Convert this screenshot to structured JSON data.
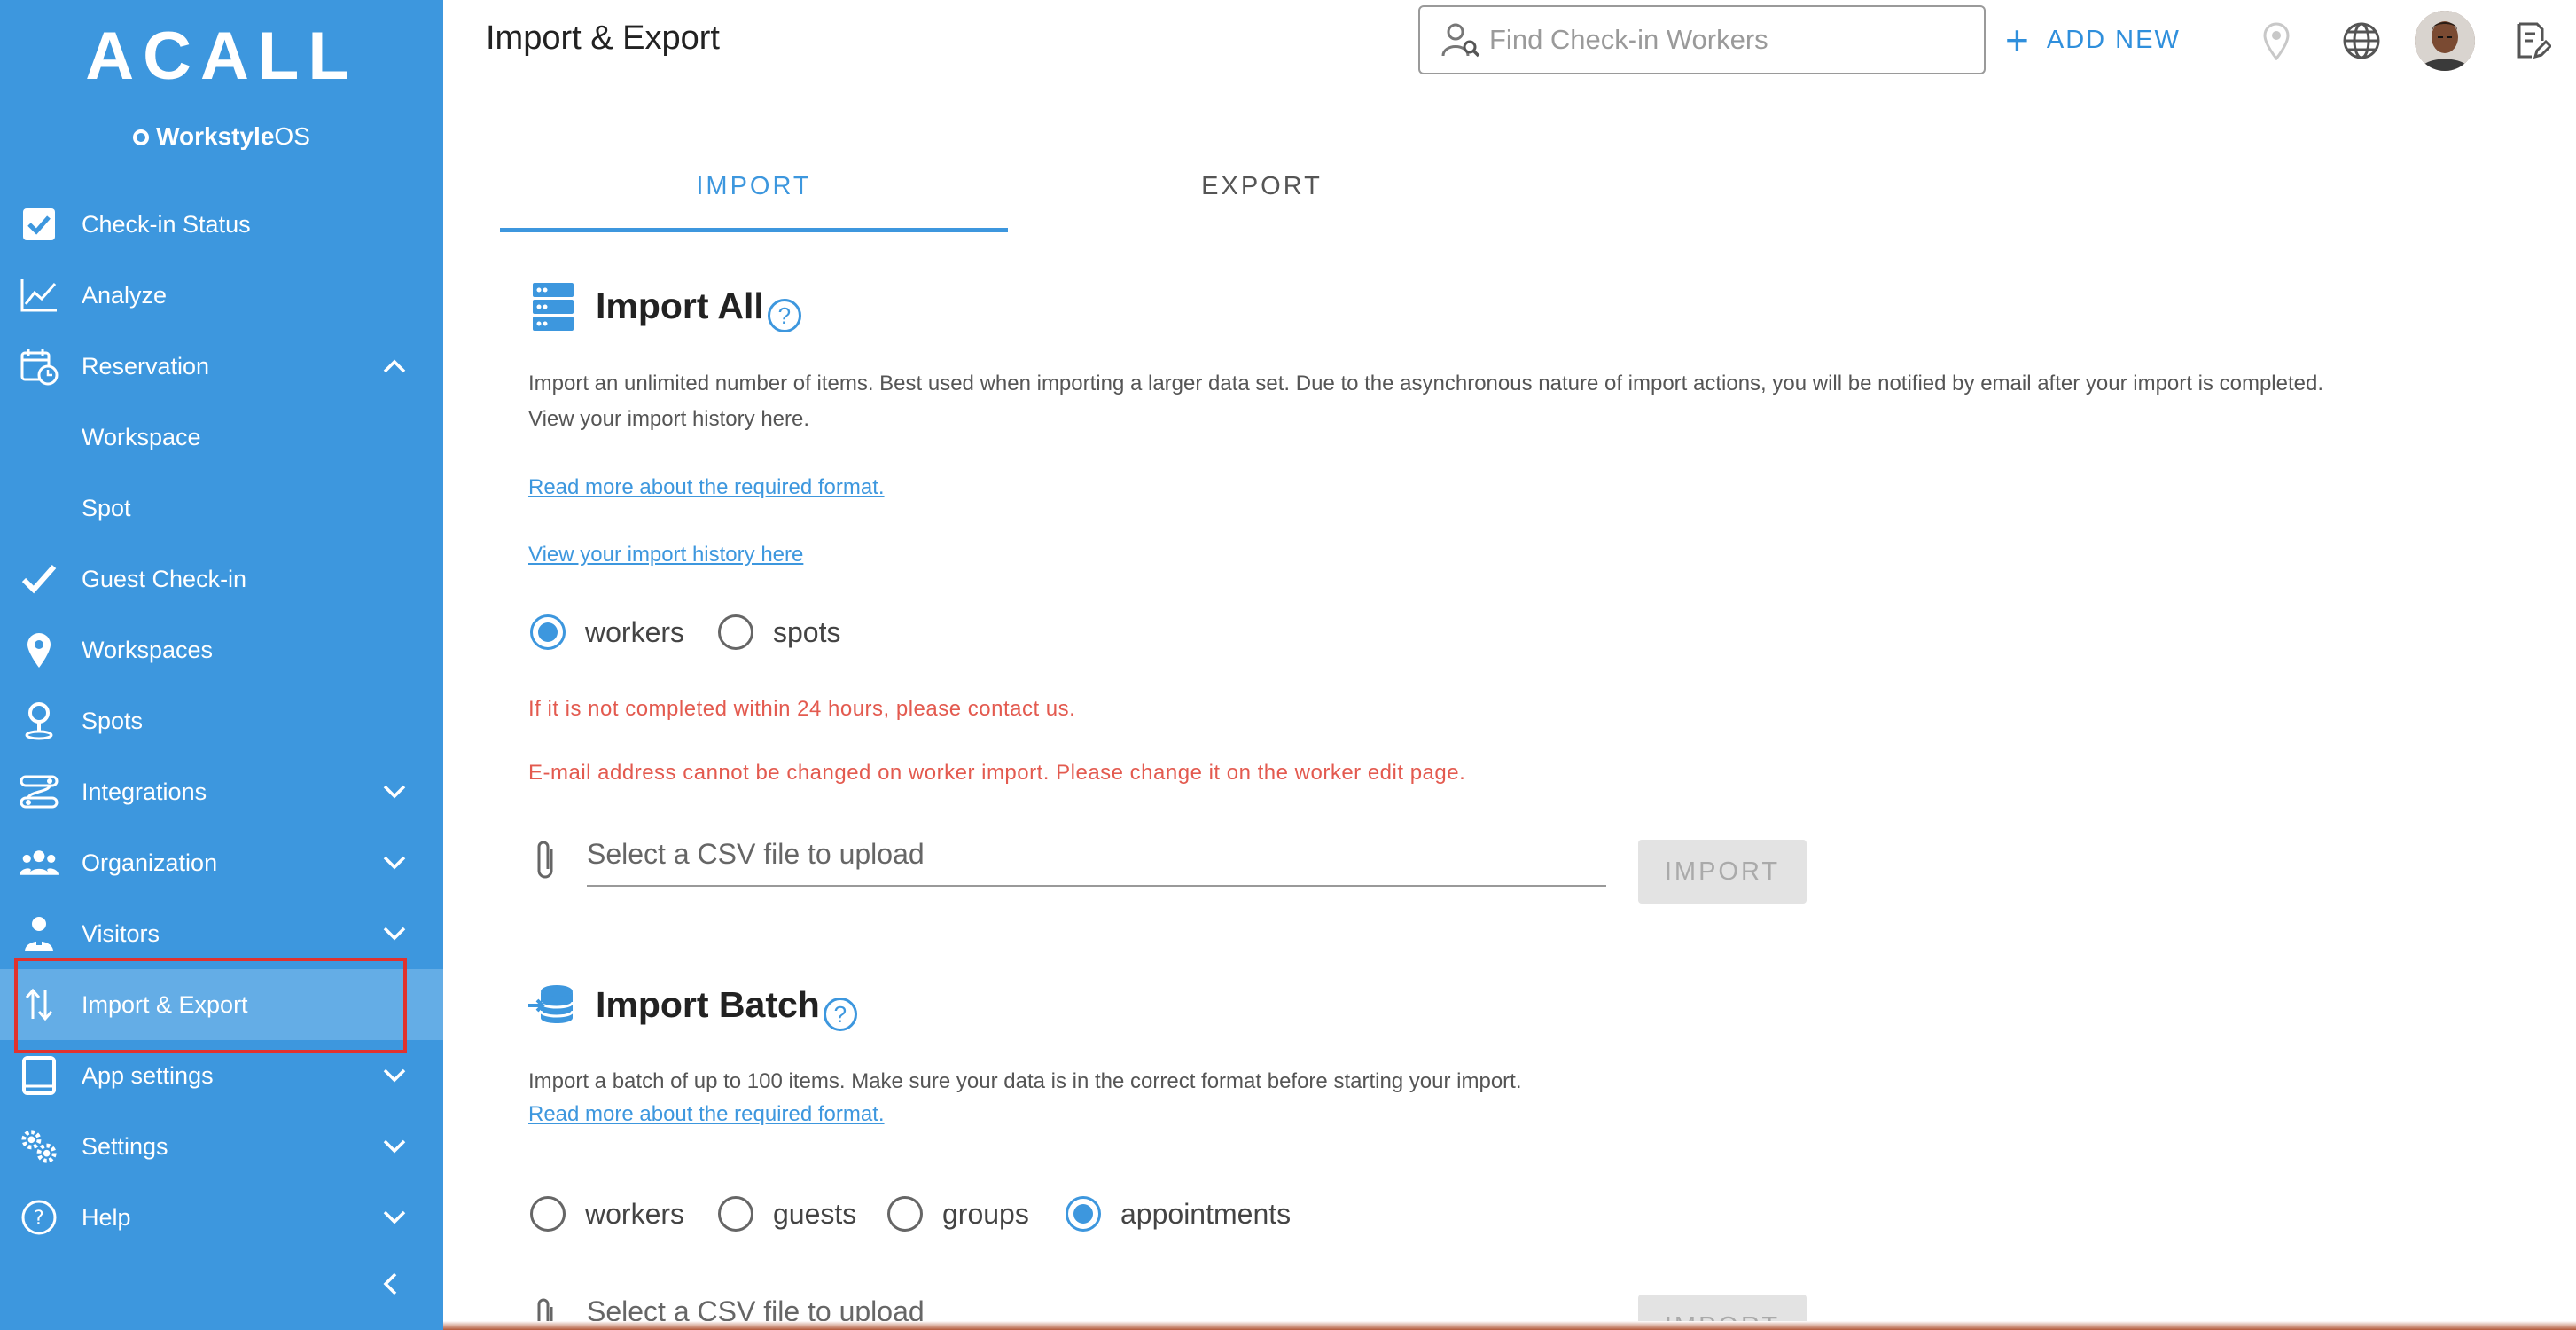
{
  "colors": {
    "sidebar": "#3d97de",
    "sidebar_active": "#64ade6",
    "accent": "#3d97de",
    "warning": "#e35a4f",
    "highlight": "#e0322e"
  },
  "brand": {
    "logo": "ACALL",
    "sub_bold": "Workstyle",
    "sub_rest": "OS"
  },
  "sidebar": {
    "items": [
      {
        "label": "Check-in Status",
        "icon": "checkbox-icon"
      },
      {
        "label": "Analyze",
        "icon": "line-chart-icon"
      },
      {
        "label": "Reservation",
        "icon": "calendar-clock-icon",
        "chevron": "up"
      },
      {
        "label": "Workspace"
      },
      {
        "label": "Spot"
      },
      {
        "label": "Guest Check-in",
        "icon": "checkmark-icon"
      },
      {
        "label": "Workspaces",
        "icon": "map-pin-icon"
      },
      {
        "label": "Spots",
        "icon": "person-pin-icon"
      },
      {
        "label": "Integrations",
        "icon": "integrations-icon",
        "chevron": "down"
      },
      {
        "label": "Organization",
        "icon": "group-icon",
        "chevron": "down"
      },
      {
        "label": "Visitors",
        "icon": "visitor-icon",
        "chevron": "down"
      },
      {
        "label": "Import & Export",
        "icon": "import-export-icon",
        "active": true
      },
      {
        "label": "App settings",
        "icon": "tablet-icon",
        "chevron": "down"
      },
      {
        "label": "Settings",
        "icon": "gears-icon",
        "chevron": "down"
      },
      {
        "label": "Help",
        "icon": "help-circle-icon",
        "chevron": "down"
      }
    ]
  },
  "header": {
    "title": "Import & Export",
    "search_placeholder": "Find Check-in Workers",
    "add_new": "ADD NEW"
  },
  "tabs": [
    {
      "label": "IMPORT",
      "active": true
    },
    {
      "label": "EXPORT",
      "active": false
    }
  ],
  "import_all": {
    "title": "Import All",
    "desc_line1": "Import an unlimited number of items. Best used when importing a larger data set. Due to the asynchronous nature of import actions, you will be notified by email after your import is completed.",
    "desc_line2": "View your import history here.",
    "format_link": "Read more about the required format.",
    "history_link": "View your import history here",
    "radios": [
      {
        "label": "workers",
        "checked": true
      },
      {
        "label": "spots",
        "checked": false
      }
    ],
    "warning1": "If it is not completed within 24 hours, please contact us.",
    "warning2": "E-mail address cannot be changed on worker import. Please change it on the worker edit page.",
    "file_placeholder": "Select a CSV file to upload",
    "button": "IMPORT"
  },
  "import_batch": {
    "title": "Import Batch",
    "desc": "Import a batch of up to 100 items. Make sure your data is in the correct format before starting your import.",
    "format_link": "Read more about the required format.",
    "radios": [
      {
        "label": "workers",
        "checked": false
      },
      {
        "label": "guests",
        "checked": false
      },
      {
        "label": "groups",
        "checked": false
      },
      {
        "label": "appointments",
        "checked": true
      }
    ],
    "file_placeholder": "Select a CSV file to upload",
    "button": "IMPORT"
  }
}
